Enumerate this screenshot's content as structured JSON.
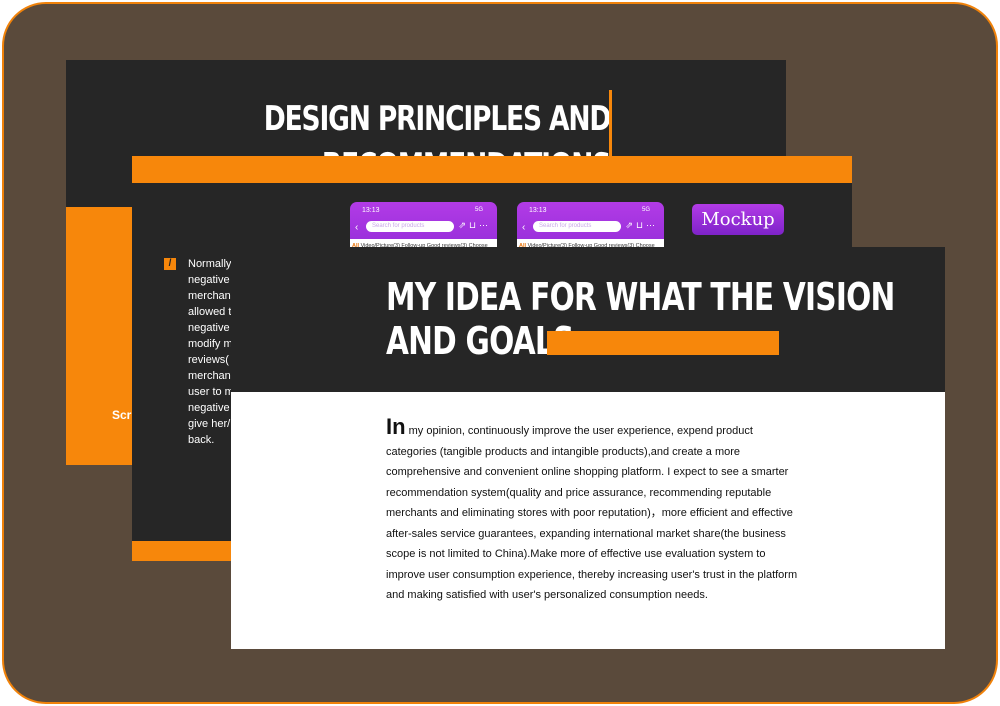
{
  "slide1": {
    "title_line1": "DESIGN PRINCIPLES AND",
    "title_line2": "RECOMMENDATIONS",
    "side_label": "Scr"
  },
  "slide2": {
    "bullet": "/",
    "paragraph_lines": [
      "Normally",
      "negative",
      "merchan",
      "allowed t",
      "negative",
      "modify m",
      "reviews(",
      "merchan",
      "user to m",
      "negative",
      "give her/",
      "back."
    ],
    "phones": [
      {
        "time": "13:13",
        "signal": "5G",
        "search_placeholder": "Search for products",
        "tabs_all": "All",
        "tabs_rest": "Video/Picture(3)  Follow-up  Good reviews(3)   Choose"
      },
      {
        "time": "13:13",
        "signal": "5G",
        "search_placeholder": "Search for products",
        "tabs_all": "All",
        "tabs_rest": "Video/Picture(3)  Follow-up  Good reviews(3)   Choose"
      }
    ],
    "mockup_label": "Mockup"
  },
  "slide3": {
    "title_line1": "MY IDEA FOR WHAT THE VISION",
    "title_line2": "AND GOALS",
    "body_first_word": "In",
    "body_text": " my opinion, continuously improve the user experience, expend product categories (tangible products and intangible products),and create a more comprehensive and convenient online shopping platform. I expect to see a smarter recommendation system(quality and price assurance, recommending reputable merchants and eliminating stores with poor reputation)，more efficient and effective after-sales service guarantees, expanding international market share(the business scope is not limited to China).Make more of effective use evaluation system to improve user consumption experience, thereby increasing user's trust in the platform and making satisfied with user's personalized consumption needs."
  },
  "colors": {
    "frame_bg": "#5a4a3b",
    "frame_border": "#f0820a",
    "slide_dark": "#262626",
    "accent_orange": "#f7870b",
    "accent_purple": "#9b30e0"
  }
}
